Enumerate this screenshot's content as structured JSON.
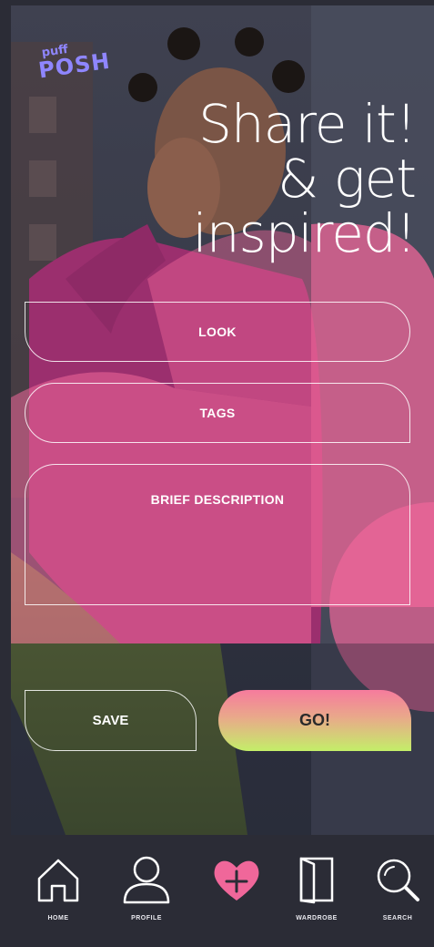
{
  "app": {
    "logo_top": "puff",
    "logo_bottom": "POSH"
  },
  "hero": {
    "line1": "Share it!",
    "line2": "& get",
    "line3": "inspired!"
  },
  "form": {
    "look_label": "LOOK",
    "tags_label": "TAGS",
    "description_label": "BRIEF DESCRIPTION"
  },
  "actions": {
    "save_label": "SAVE",
    "go_label": "GO!"
  },
  "nav": {
    "home_label": "HOME",
    "profile_label": "PROFILE",
    "wardrobe_label": "WARDROBE",
    "search_label": "SEARCH"
  },
  "colors": {
    "accent_pink": "#f0679a",
    "accent_lime": "#c4ee69",
    "logo_purple": "#8f86ff",
    "nav_background": "#2b2c36"
  },
  "icons": [
    "home-icon",
    "profile-icon",
    "add-heart-icon",
    "wardrobe-icon",
    "search-icon"
  ]
}
